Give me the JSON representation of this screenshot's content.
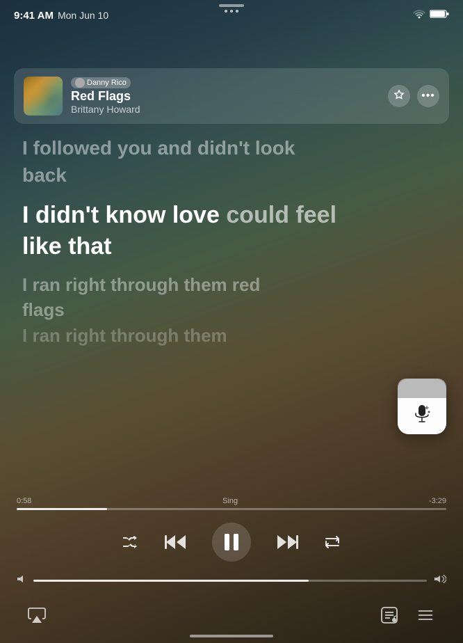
{
  "status": {
    "time": "9:41 AM",
    "date": "Mon Jun 10",
    "wifi_level": "100%",
    "battery": "100%"
  },
  "track": {
    "user": "Danny Rico",
    "title": "Red Flags",
    "artist": "Brittany Howard",
    "album_art_alt": "Red Flags album art"
  },
  "actions": {
    "star_label": "★",
    "more_label": "•••"
  },
  "lyrics": {
    "prev1": "I followed you and didn't look",
    "prev2": "back",
    "current1": "I didn't know love",
    "current2": " could feel",
    "current3": "like that",
    "next1": "I ran right through them red",
    "next2": "flags",
    "far1": "I ran right through them"
  },
  "player": {
    "time_elapsed": "0:58",
    "time_remaining": "-3:29",
    "sing_label": "Sing",
    "progress_pct": 21,
    "volume_pct": 70
  },
  "controls": {
    "shuffle": "shuffle",
    "rewind": "rewind",
    "pause": "pause",
    "fast_forward": "fast-forward",
    "repeat": "repeat"
  },
  "bottom_bar": {
    "airplay": "airplay",
    "lyrics": "lyrics",
    "queue": "queue"
  },
  "sing_button": {
    "tooltip": "Sing mode"
  }
}
